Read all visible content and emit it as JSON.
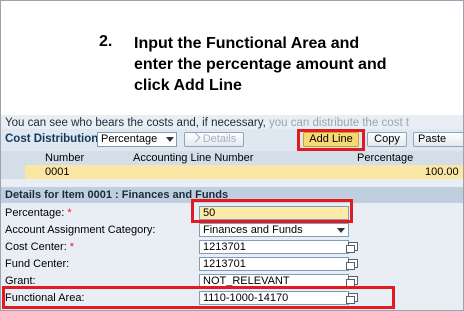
{
  "instruction": {
    "step_number": "2.",
    "line1": "Input the Functional Area and",
    "line2": "enter the percentage amount and",
    "line3": "click Add Line"
  },
  "info_text": {
    "visible": "You can see who bears the costs and, if necessary, ",
    "faded": "you can distribute the cost t"
  },
  "toolbar": {
    "title": "Cost Distribution",
    "mode_select": "Percentage",
    "details_label": "Details",
    "add_line_label": "Add Line",
    "copy_label": "Copy",
    "paste_label": "Paste"
  },
  "table": {
    "columns": [
      "Number",
      "Accounting Line Number",
      "Percentage"
    ],
    "rows": [
      {
        "number": "0001",
        "accounting_line": "",
        "percentage": "100.00"
      }
    ]
  },
  "details_header": "Details for Item 0001 : Finances and Funds",
  "form": {
    "percentage_label": "Percentage:",
    "percentage_value": "50",
    "category_label": "Account Assignment Category:",
    "category_value": "Finances and Funds",
    "cost_center_label": "Cost Center:",
    "cost_center_value": "1213701",
    "fund_center_label": "Fund Center:",
    "fund_center_value": "1213701",
    "grant_label": "Grant:",
    "grant_value": "NOT_RELEVANT",
    "functional_area_label": "Functional Area:",
    "functional_area_value": "1110-1000-14170",
    "required_marker": "*"
  },
  "colors": {
    "highlight": "#e21a22",
    "selected_row": "#fbe7a4",
    "add_button": "#f7d874"
  }
}
